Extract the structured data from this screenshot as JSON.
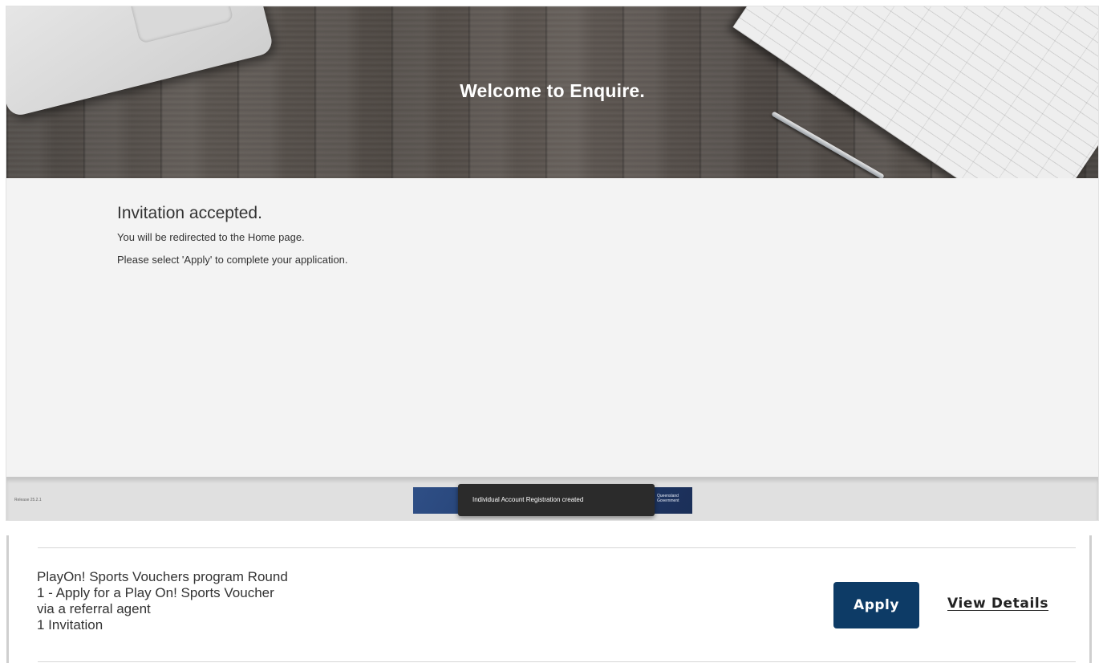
{
  "hero": {
    "title": "Welcome to Enquire."
  },
  "invitation": {
    "title": "Invitation accepted.",
    "line1": "You will be redirected to the Home page.",
    "line2": "Please select 'Apply' to complete your application."
  },
  "footer": {
    "release": "Release 25.2.1",
    "gov_label": "Queensland Government"
  },
  "toast": {
    "message": "Individual Account Registration created"
  },
  "program": {
    "title_line1": "PlayOn! Sports Vouchers program Round",
    "title_line2": "1 - Apply for a Play On! Sports Voucher",
    "title_line3": "via a referral agent",
    "invitations": "1 Invitation",
    "apply_label": "Apply",
    "view_details_label": "View Details"
  },
  "colors": {
    "apply_button": "#0d3b66",
    "toast_background": "#2b2b2b",
    "content_background": "#f3f3f3"
  }
}
